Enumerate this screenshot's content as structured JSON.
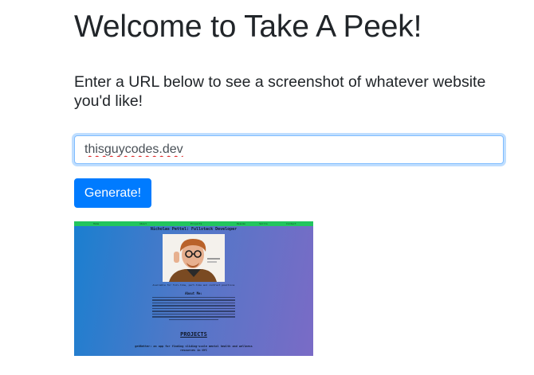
{
  "page": {
    "title": "Welcome to Take A Peek!",
    "intro": "Enter a URL below to see a screenshot of whatever website you'd like!"
  },
  "form": {
    "url_value": "thisguycodes.dev",
    "generate_label": "Generate!"
  },
  "screenshot": {
    "nav_items": [
      "Home",
      "About",
      "Projects",
      "Resume",
      "Skills",
      "Contact"
    ],
    "heading": "Nicholas Pettel: Fullstack Developer",
    "photo_caption": "Available for full-time, part-time and contract positions",
    "about_heading": "About Me:",
    "projects_heading": "PROJECTS",
    "project_line_1": "getBetter: an app for finding sliding-scale mental health and wellness",
    "project_line_2": "resources in NYC",
    "colors": {
      "nav": "#22c55e",
      "gradient_start": "#1a7fd0",
      "gradient_end": "#7a6bc6"
    }
  },
  "colors": {
    "primary_button": "#007bff",
    "input_focus_border": "#80bdff",
    "text": "#212529"
  }
}
